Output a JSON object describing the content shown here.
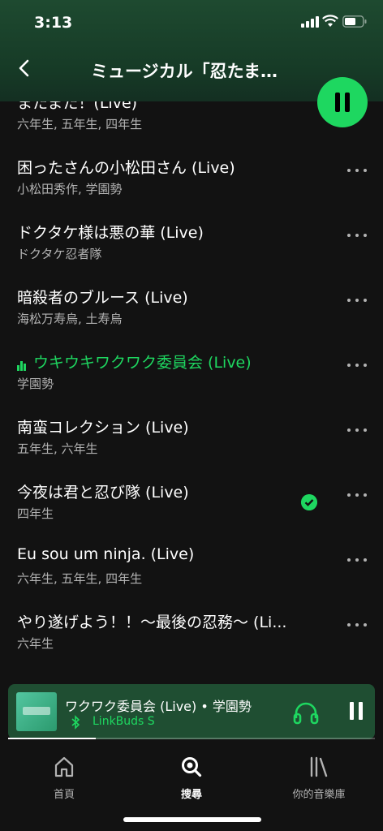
{
  "status": {
    "time": "3:13"
  },
  "header": {
    "title": "ミュージカル「忍たま…"
  },
  "tracks": [
    {
      "title": "またまた！(Live)",
      "artists": "六年生, 五年生, 四年生"
    },
    {
      "title": "困ったさんの小松田さん (Live)",
      "artists": "小松田秀作, 学園勢"
    },
    {
      "title": "ドクタケ様は悪の華 (Live)",
      "artists": "ドクタケ忍者隊"
    },
    {
      "title": "暗殺者のブルース (Live)",
      "artists": "海松万寿烏, 土寿烏"
    },
    {
      "title": "ウキウキワクワク委員会 (Live)",
      "artists": "学園勢",
      "playing": true
    },
    {
      "title": "南蛮コレクション (Live)",
      "artists": "五年生, 六年生"
    },
    {
      "title": "今夜は君と忍び隊 (Live)",
      "artists": "四年生",
      "downloaded": true
    },
    {
      "title": "Eu sou um ninja. (Live)",
      "artists": "六年生, 五年生, 四年生"
    },
    {
      "title": "やり遂げよう！！～最後の忍務～ (Li...",
      "artists": "六年生"
    }
  ],
  "now_playing": {
    "title": "ワクワク委員会 (Live) • 学園勢",
    "device": "LinkBuds S",
    "progress": 0.24
  },
  "tabs": [
    {
      "label": "首頁",
      "icon": "home-icon"
    },
    {
      "label": "搜尋",
      "icon": "search-icon",
      "active": true
    },
    {
      "label": "你的音樂庫",
      "icon": "library-icon"
    }
  ],
  "colors": {
    "accent": "#1ed760",
    "background": "#121212",
    "header": "#1e4a30",
    "miniplayer": "#1f4e32"
  }
}
